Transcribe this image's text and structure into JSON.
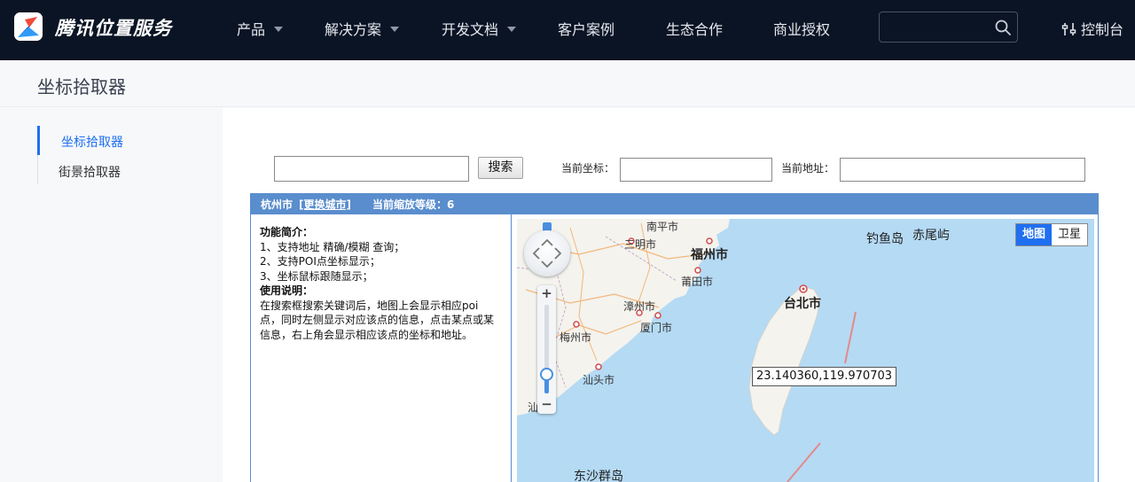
{
  "brand": {
    "name": "腾讯位置服务"
  },
  "nav": {
    "items": [
      {
        "label": "产品",
        "has_menu": true
      },
      {
        "label": "解决方案",
        "has_menu": true
      },
      {
        "label": "开发文档",
        "has_menu": true
      },
      {
        "label": "客户案例",
        "has_menu": false
      },
      {
        "label": "生态合作",
        "has_menu": false
      },
      {
        "label": "商业授权",
        "has_menu": false
      }
    ],
    "search": {
      "value": "",
      "placeholder": ""
    },
    "console_label": "控制台"
  },
  "page": {
    "title": "坐标拾取器"
  },
  "sidebar": {
    "items": [
      {
        "label": "坐标拾取器",
        "active": true
      },
      {
        "label": "街景拾取器",
        "active": false
      }
    ]
  },
  "picker": {
    "search_value": "",
    "search_button": "搜索",
    "coord_label": "当前坐标：",
    "coord_value": "",
    "address_label": "当前地址：",
    "address_value": "",
    "city": "杭州市",
    "change_city": "[更换城市]",
    "zoom_text": "当前缩放等级：6",
    "zoom_level": 6,
    "intro_title": "功能简介：",
    "intro_lines": [
      "1、支持地址 精确/模糊 查询；",
      "2、支持POI点坐标显示；",
      "3、坐标鼠标跟随显示；"
    ],
    "usage_title": "使用说明：",
    "usage_text": "在搜索框搜索关键词后，地图上会显示相应poi点，同时左侧显示对应该点的信息，点击某点或某信息，右上角会显示相应该点的坐标和地址。"
  },
  "map": {
    "cursor_coord": "23.140360,119.970703",
    "type_map": "地图",
    "type_satellite": "卫星",
    "zoom_slider_fraction": 0.22,
    "colors": {
      "sea": "#b5daf4",
      "land": "#f4f3ee",
      "accent": "#1f6ff1"
    },
    "labels": {
      "nanping": "南平市",
      "sanming": "三明市",
      "fuzhou": "福州市",
      "putian": "莆田市",
      "zhangzhou": "漳州市",
      "xiamen": "厦门市",
      "meizhou": "梅州市",
      "shantou": "汕头市",
      "shanwei": "汕",
      "taipei": "台北市",
      "diaoyu": "钓鱼岛",
      "chiwei": "赤尾屿",
      "dongsha": "东沙群岛"
    }
  }
}
